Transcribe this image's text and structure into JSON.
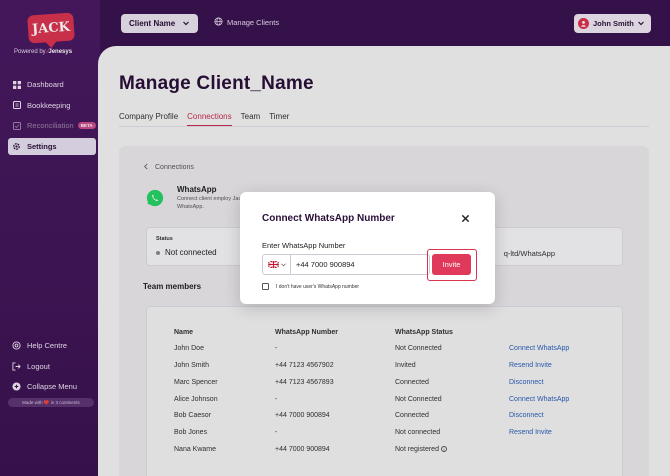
{
  "brand": {
    "logo_text": "JACK",
    "powered_prefix": "Powered by",
    "powered_name": "Jenesys",
    "made_with": "Made with ❤️ in 3 continents"
  },
  "sidebar": {
    "items": [
      {
        "label": "Dashboard",
        "icon": "grid-icon"
      },
      {
        "label": "Bookkeeping",
        "icon": "book-icon"
      },
      {
        "label": "Reconciliation",
        "icon": "reconcile-icon",
        "badge": "BETA",
        "disabled": true
      },
      {
        "label": "Settings",
        "icon": "gear-icon",
        "active": true
      }
    ],
    "bottom_items": [
      {
        "label": "Help Centre",
        "icon": "help-icon"
      },
      {
        "label": "Logout",
        "icon": "logout-icon"
      },
      {
        "label": "Collapse Menu",
        "icon": "collapse-icon"
      }
    ]
  },
  "topbar": {
    "client_select": "Client Name",
    "manage_clients": "Manage Clients",
    "user_name": "John Smith"
  },
  "page": {
    "title": "Manage Client_Name",
    "tabs": [
      "Company Profile",
      "Connections",
      "Team",
      "Timer"
    ],
    "active_tab": "Connections"
  },
  "connection": {
    "back_label": "Connections",
    "name": "WhatsApp",
    "description": "Connect client employ Jack via WhatsApp.",
    "status_label": "Status",
    "status_value": "Not connected",
    "path_fragment": "q-ltd/WhatsApp"
  },
  "team": {
    "heading": "Team members",
    "columns": [
      "Name",
      "WhatsApp Number",
      "WhatsApp Status"
    ],
    "rows": [
      {
        "name": "John Doe",
        "number": "-",
        "status": "Not Connected",
        "action": "Connect WhatsApp"
      },
      {
        "name": "John Smith",
        "number": "+44 7123 4567902",
        "status": "Invited",
        "action": "Resend Invite"
      },
      {
        "name": "Marc Spencer",
        "number": "+44 7123 4567893",
        "status": "Connected",
        "action": "Disconnect"
      },
      {
        "name": "Alice Johnson",
        "number": "-",
        "status": "Not Connected",
        "action": "Connect WhatsApp"
      },
      {
        "name": "Bob Caesor",
        "number": "+44 7000 900894",
        "status": "Connected",
        "action": "Disconnect"
      },
      {
        "name": "Bob Jones",
        "number": "-",
        "status": "Not connected",
        "action": "Resend Invite"
      },
      {
        "name": "Nana Kwame",
        "number": "+44 7000 900894",
        "status": "Not registered",
        "action": ""
      }
    ]
  },
  "modal": {
    "title": "Connect WhatsApp Number",
    "field_label": "Enter WhatsApp Number",
    "phone_value": "+44 7000 900894",
    "invite_label": "Invite",
    "checkbox_label": "I don't have user's WhatsApp number"
  },
  "colors": {
    "sidebar_bg": "#3a1350",
    "accent": "#e0395a",
    "link": "#2a5fb8",
    "whatsapp": "#25d366"
  }
}
